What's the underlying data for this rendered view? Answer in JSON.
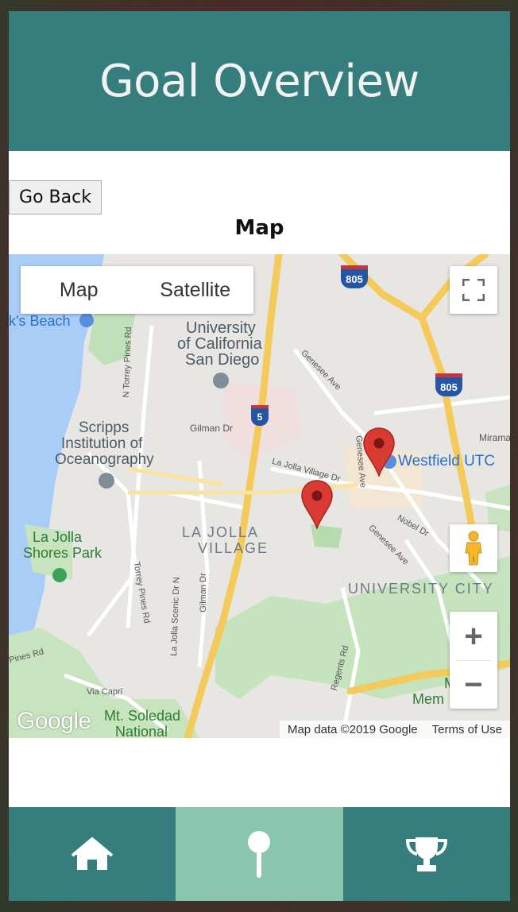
{
  "header": {
    "title": "Goal Overview"
  },
  "back_button": {
    "label": "Go Back"
  },
  "section": {
    "title": "Map"
  },
  "map": {
    "type_control": {
      "options": [
        "Map",
        "Satellite"
      ],
      "selected": "Map"
    },
    "zoom": {
      "in": "+",
      "out": "−"
    },
    "attribution": {
      "data": "Map data ©2019 Google",
      "terms": "Terms of Use"
    },
    "logo": "Google",
    "labels": {
      "beach": "k's Beach",
      "ucsd_1": "University",
      "ucsd_2": "of California",
      "ucsd_3": "San Diego",
      "scripps_1": "Scripps",
      "scripps_2": "Institution of",
      "scripps_3": "Oceanography",
      "lajolla_shores_1": "La Jolla",
      "lajolla_shores_2": "Shores Park",
      "village_1": "LA JOLLA",
      "village_2": "VILLAGE",
      "university_city": "UNIVERSITY CITY",
      "westfield": "Westfield UTC",
      "soledad_1": "Mt. Soledad",
      "soledad_2": "National",
      "torrey_pines_n": "N Torrey Pines Rd",
      "torrey_pines": "Torrey Pines Rd",
      "gilman": "Gilman Dr",
      "gilman_2": "Gilman Dr",
      "genesee": "Genesee Ave",
      "genesee_2": "Genesee Ave",
      "genesee_3": "Genesee Ave",
      "la_jolla_village_dr": "La Jolla Village Dr",
      "nobel": "Nobel Dr",
      "regents": "Regents Rd",
      "via_capri": "Via Capri",
      "pines_rd": "Pines Rd",
      "scenic": "La Jolla Scenic Dr N",
      "mirama": "Mirama",
      "marian_1": "Mar",
      "marian_2": "Mem",
      "shield_805": "805",
      "shield_805_b": "805",
      "shield_5": "5"
    },
    "markers": [
      {
        "name": "marker-westfield",
        "color": "#d93a32"
      },
      {
        "name": "marker-village",
        "color": "#d93a32"
      }
    ]
  },
  "nav": {
    "items": [
      {
        "icon": "home-icon",
        "active": false
      },
      {
        "icon": "map-pin-icon",
        "active": true
      },
      {
        "icon": "trophy-icon",
        "active": false
      }
    ]
  },
  "colors": {
    "header": "#367e7e",
    "nav": "#367e7e",
    "nav_active": "#8ac6ad",
    "marker": "#d93a32"
  }
}
